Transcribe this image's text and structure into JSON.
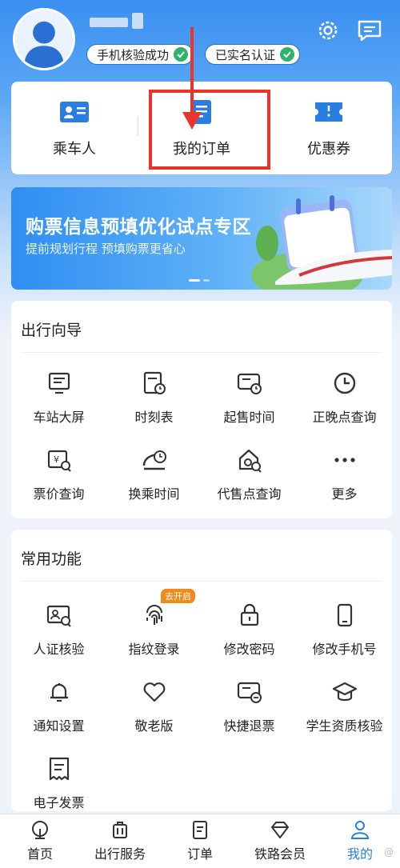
{
  "header": {
    "badges": [
      {
        "label": "手机核验成功"
      },
      {
        "label": "已实名认证"
      }
    ]
  },
  "quick": [
    {
      "label": "乘车人",
      "icon": "passenger-card-icon"
    },
    {
      "label": "我的订单",
      "icon": "order-icon"
    },
    {
      "label": "优惠券",
      "icon": "coupon-icon"
    }
  ],
  "banner": {
    "title": "购票信息预填优化试点专区",
    "subtitle": "提前规划行程 预填购票更省心"
  },
  "travel_guide": {
    "title": "出行向导",
    "items": [
      {
        "label": "车站大屏",
        "icon": "screen-icon"
      },
      {
        "label": "时刻表",
        "icon": "timetable-icon"
      },
      {
        "label": "起售时间",
        "icon": "sale-time-icon"
      },
      {
        "label": "正晚点查询",
        "icon": "clock-icon"
      },
      {
        "label": "票价查询",
        "icon": "price-search-icon"
      },
      {
        "label": "换乘时间",
        "icon": "transfer-time-icon"
      },
      {
        "label": "代售点查询",
        "icon": "agency-search-icon"
      },
      {
        "label": "更多",
        "icon": "more-icon"
      }
    ]
  },
  "common": {
    "title": "常用功能",
    "items": [
      {
        "label": "人证核验",
        "icon": "id-verify-icon"
      },
      {
        "label": "指纹登录",
        "icon": "fingerprint-icon",
        "tag": "去开启"
      },
      {
        "label": "修改密码",
        "icon": "lock-icon"
      },
      {
        "label": "修改手机号",
        "icon": "phone-icon"
      },
      {
        "label": "通知设置",
        "icon": "bell-icon"
      },
      {
        "label": "敬老版",
        "icon": "heart-icon"
      },
      {
        "label": "快捷退票",
        "icon": "refund-icon"
      },
      {
        "label": "学生资质核验",
        "icon": "graduation-cap-icon"
      },
      {
        "label": "电子发票",
        "icon": "invoice-icon"
      }
    ]
  },
  "tabbar": [
    {
      "label": "首页",
      "icon": "home-train-icon"
    },
    {
      "label": "出行服务",
      "icon": "luggage-icon"
    },
    {
      "label": "订单",
      "icon": "order-list-icon"
    },
    {
      "label": "铁路会员",
      "icon": "diamond-icon"
    },
    {
      "label": "我的",
      "icon": "profile-icon",
      "active": true
    }
  ],
  "colors": {
    "accent": "#2a7de1",
    "highlight": "#e8352a",
    "success": "#2fb36a",
    "tag": "#f08a1c"
  }
}
